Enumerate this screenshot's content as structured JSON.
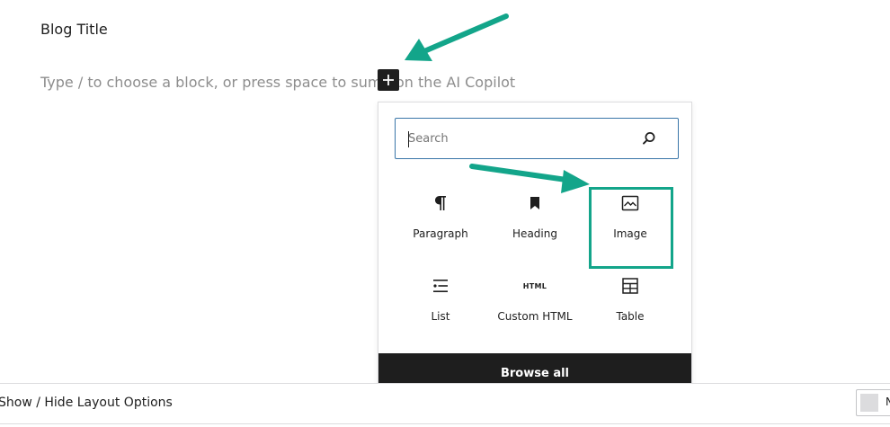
{
  "editor": {
    "title": "Blog Title",
    "placeholder": "Type / to choose a block, or press space to summon the AI Copilot"
  },
  "inserter": {
    "toggle_icon": "plus-icon",
    "search": {
      "placeholder": "Search",
      "value": ""
    },
    "blocks": [
      {
        "label": "Paragraph",
        "icon": "paragraph-icon"
      },
      {
        "label": "Heading",
        "icon": "bookmark-icon"
      },
      {
        "label": "Image",
        "icon": "image-icon"
      },
      {
        "label": "List",
        "icon": "list-icon"
      },
      {
        "label": "Custom HTML",
        "icon": "html-icon",
        "icon_text": "HTML"
      },
      {
        "label": "Table",
        "icon": "table-icon"
      }
    ],
    "browse_all_label": "Browse all"
  },
  "bottom_bar": {
    "layout_toggle_label": "Show / Hide Layout Options",
    "corner_text": "N"
  },
  "colors": {
    "annotation": "#13a58a",
    "search_border": "#3a76a8",
    "dark": "#1e1e1e"
  }
}
